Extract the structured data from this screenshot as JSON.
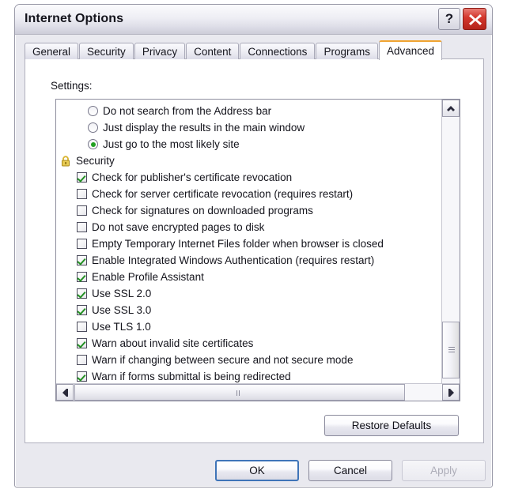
{
  "window": {
    "title": "Internet Options",
    "help_button": "?",
    "close_button": "close-icon"
  },
  "tabs": [
    {
      "label": "General",
      "active": false
    },
    {
      "label": "Security",
      "active": false
    },
    {
      "label": "Privacy",
      "active": false
    },
    {
      "label": "Content",
      "active": false
    },
    {
      "label": "Connections",
      "active": false
    },
    {
      "label": "Programs",
      "active": false
    },
    {
      "label": "Advanced",
      "active": true
    }
  ],
  "page": {
    "settings_label": "Settings:",
    "rows": [
      {
        "kind": "radio",
        "label": "Do not search from the Address bar",
        "checked": false
      },
      {
        "kind": "radio",
        "label": "Just display the results in the main window",
        "checked": false
      },
      {
        "kind": "radio",
        "label": "Just go to the most likely site",
        "checked": true
      },
      {
        "kind": "group",
        "label": "Security",
        "icon": "lock-icon"
      },
      {
        "kind": "checkbox",
        "label": "Check for publisher's certificate revocation",
        "checked": true
      },
      {
        "kind": "checkbox",
        "label": "Check for server certificate revocation (requires restart)",
        "checked": false
      },
      {
        "kind": "checkbox",
        "label": "Check for signatures on downloaded programs",
        "checked": false
      },
      {
        "kind": "checkbox",
        "label": "Do not save encrypted pages to disk",
        "checked": false
      },
      {
        "kind": "checkbox",
        "label": "Empty Temporary Internet Files folder when browser is closed",
        "checked": false
      },
      {
        "kind": "checkbox",
        "label": "Enable Integrated Windows Authentication (requires restart)",
        "checked": true
      },
      {
        "kind": "checkbox",
        "label": "Enable Profile Assistant",
        "checked": true
      },
      {
        "kind": "checkbox",
        "label": "Use SSL 2.0",
        "checked": true
      },
      {
        "kind": "checkbox",
        "label": "Use SSL 3.0",
        "checked": true
      },
      {
        "kind": "checkbox",
        "label": "Use TLS 1.0",
        "checked": false
      },
      {
        "kind": "checkbox",
        "label": "Warn about invalid site certificates",
        "checked": true
      },
      {
        "kind": "checkbox",
        "label": "Warn if changing between secure and not secure mode",
        "checked": false
      },
      {
        "kind": "checkbox",
        "label": "Warn if forms submittal is being redirected",
        "checked": true
      }
    ],
    "restore_defaults_label": "Restore Defaults"
  },
  "footer": {
    "ok_label": "OK",
    "cancel_label": "Cancel",
    "apply_label": "Apply",
    "apply_enabled": false
  },
  "colors": {
    "accent_tab": "#f0a432",
    "focus_border": "#3f74b8",
    "check_green": "#239023",
    "close_red": "#d4372d",
    "lock_gold": "#d9b430"
  }
}
